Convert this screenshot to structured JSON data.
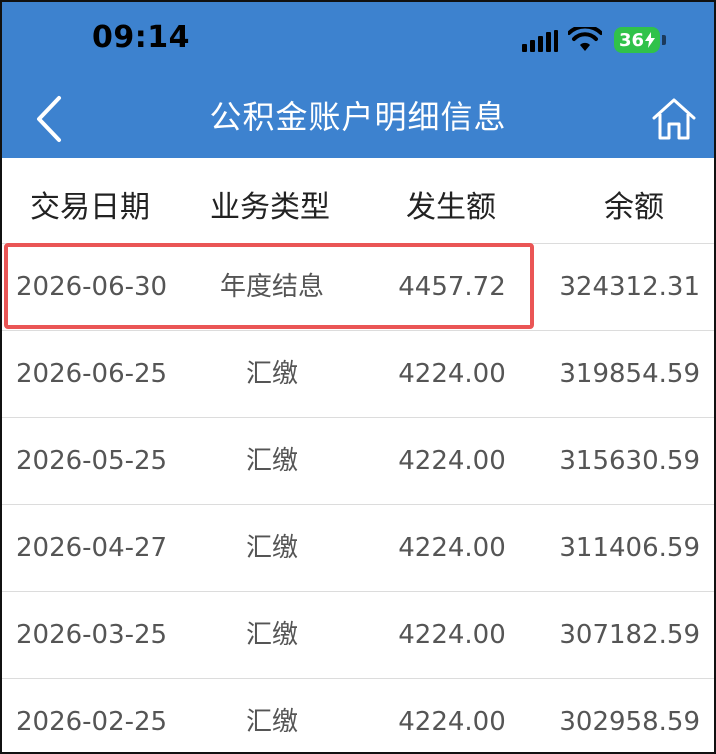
{
  "status_bar": {
    "time": "09:14",
    "battery": "36",
    "icons": [
      "cellular-signal-icon",
      "wifi-icon",
      "battery-charging-icon"
    ]
  },
  "nav": {
    "title": "公积金账户明细信息",
    "back_icon": "chevron-left-icon",
    "home_icon": "home-icon"
  },
  "table": {
    "headers": [
      "交易日期",
      "业务类型",
      "发生额",
      "余额"
    ],
    "rows": [
      {
        "date": "2026-06-30",
        "type": "年度结息",
        "amount": "4457.72",
        "balance": "324312.31"
      },
      {
        "date": "2026-06-25",
        "type": "汇缴",
        "amount": "4224.00",
        "balance": "319854.59"
      },
      {
        "date": "2026-05-25",
        "type": "汇缴",
        "amount": "4224.00",
        "balance": "315630.59"
      },
      {
        "date": "2026-04-27",
        "type": "汇缴",
        "amount": "4224.00",
        "balance": "311406.59"
      },
      {
        "date": "2026-03-25",
        "type": "汇缴",
        "amount": "4224.00",
        "balance": "307182.59"
      },
      {
        "date": "2026-02-25",
        "type": "汇缴",
        "amount": "4224.00",
        "balance": "302958.59"
      }
    ]
  },
  "colors": {
    "header_blue": "#3d82cf",
    "highlight_red": "#ea5555",
    "battery_green": "#30c24a"
  }
}
